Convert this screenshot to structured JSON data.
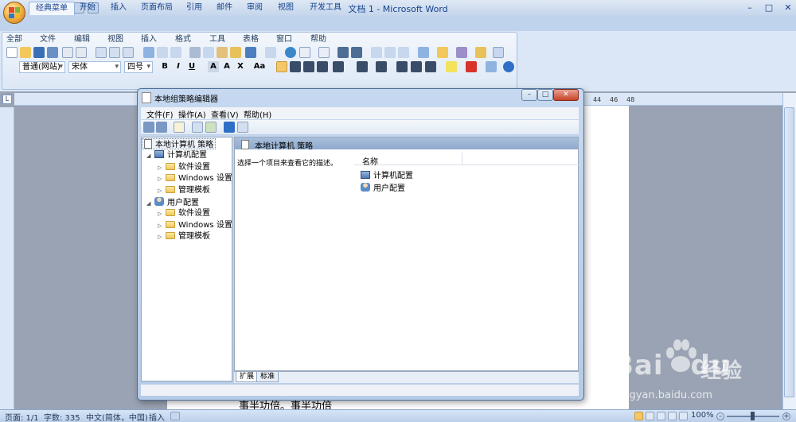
{
  "app": {
    "title": "文档 1 - Microsoft Word",
    "window_controls": [
      "–",
      "□",
      "✕"
    ]
  },
  "ribbon": {
    "tabs": [
      {
        "label": "经典菜单",
        "active": true
      },
      {
        "label": "开始"
      },
      {
        "label": "插入"
      },
      {
        "label": "页面布局"
      },
      {
        "label": "引用"
      },
      {
        "label": "邮件"
      },
      {
        "label": "审阅"
      },
      {
        "label": "视图"
      },
      {
        "label": "开发工具"
      }
    ]
  },
  "classic_menu": {
    "menus": [
      "全部",
      "文件",
      "编辑",
      "视图",
      "插入",
      "格式",
      "工具",
      "表格",
      "窗口",
      "帮助"
    ],
    "style_value": "普通(网站)",
    "font_value": "宋体",
    "size_value": "四号",
    "format_buttons": [
      "B",
      "I",
      "U",
      "A",
      "A",
      "X",
      "Aa"
    ]
  },
  "ruler": {
    "numbers": [
      "44",
      "46",
      "48"
    ]
  },
  "document": {
    "text": "事半功倍。事半功倍"
  },
  "statusbar": {
    "page": "页面: 1/1",
    "words": "字数: 335",
    "language": "中文(简体，中国)",
    "mode": "插入",
    "zoom": "100%"
  },
  "dialog": {
    "title": "本地组策略编辑器",
    "menus": [
      "文件(F)",
      "操作(A)",
      "查看(V)",
      "帮助(H)"
    ],
    "tree": {
      "root": "本地计算机 策略",
      "computer": "计算机配置",
      "computer_children": [
        "软件设置",
        "Windows 设置",
        "管理模板"
      ],
      "user": "用户配置",
      "user_children": [
        "软件设置",
        "Windows 设置",
        "管理模板"
      ]
    },
    "right": {
      "header_title": "本地计算机 策略",
      "description": "选择一个项目来查看它的描述。",
      "column_name": "名称",
      "rows": [
        "计算机配置",
        "用户配置"
      ]
    },
    "bottom_tabs": [
      "扩展",
      "标准"
    ]
  },
  "watermark": {
    "brand": "Bai",
    "brand2": "du",
    "suffix": "经验",
    "url": "jingyan.baidu.com"
  },
  "colors": {
    "ribbon": "#bfd3ec",
    "dialog_frame": "#c6d9f1",
    "header_band": "#a9bfdc"
  }
}
